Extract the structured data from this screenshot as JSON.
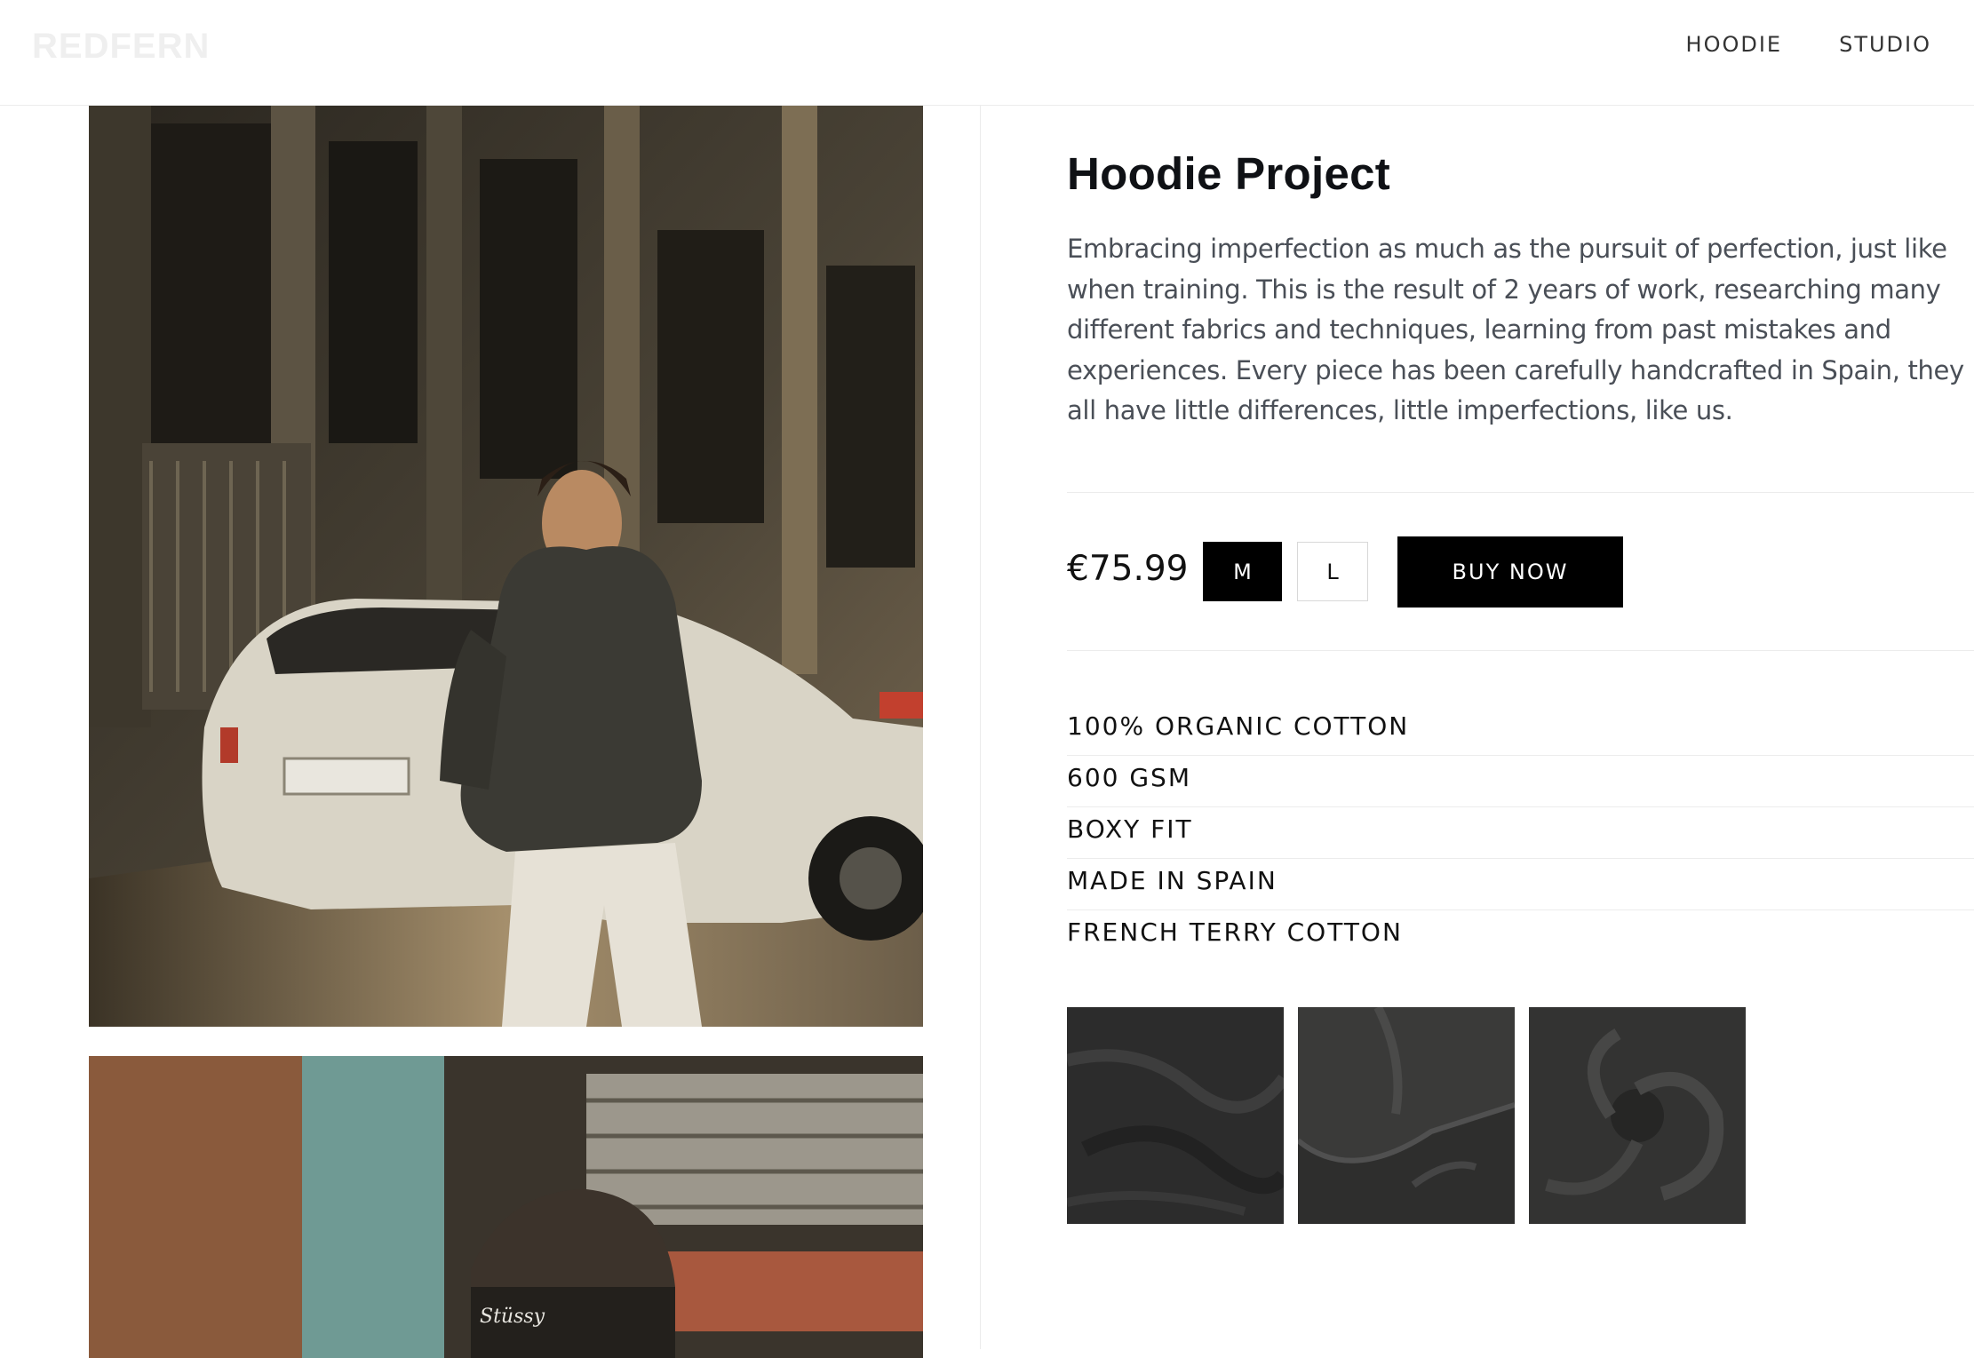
{
  "brand": {
    "logo": "REDFERN"
  },
  "nav": {
    "items": [
      "HOODIE",
      "STUDIO"
    ]
  },
  "product": {
    "title": "Hoodie Project",
    "description": "Embracing imperfection as much as the pursuit of perfection, just like when training. This is the result of 2 years of work, researching many different fabrics and techniques, learning from past mistakes and experiences. Every piece has been carefully handcrafted in Spain, they all have little differences, little imperfections, like us.",
    "price": "€75.99",
    "sizes": [
      {
        "label": "M",
        "selected": true
      },
      {
        "label": "L",
        "selected": false
      }
    ],
    "buy_label": "BUY NOW",
    "features": [
      "100% ORGANIC COTTON",
      "600 GSM",
      "BOXY FIT",
      "MADE IN SPAIN",
      "FRENCH TERRY COTTON"
    ]
  },
  "colors": {
    "accent": "#000000",
    "text": "#111111",
    "muted_text": "#4a4f57",
    "logo": "#efefef",
    "divider": "#ececec"
  }
}
